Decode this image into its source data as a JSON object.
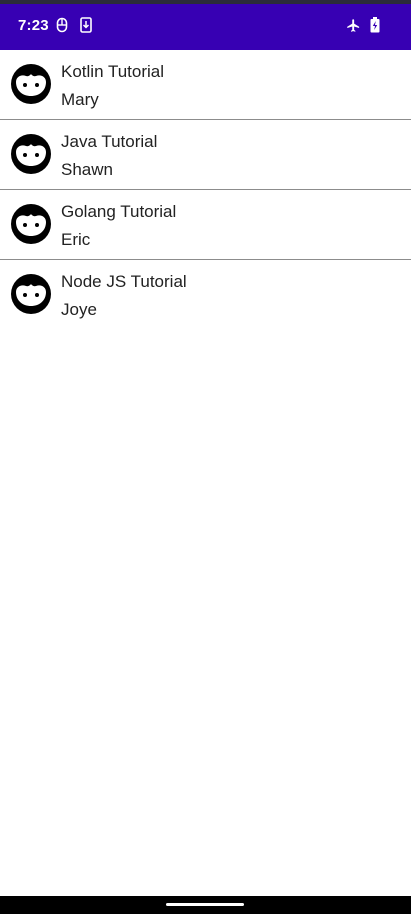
{
  "status_bar": {
    "time": "7:23",
    "background_color": "#3700b3",
    "left_icons": [
      "notification-icon",
      "download-icon"
    ],
    "right_icons": [
      "airplane-mode-icon",
      "battery-charging-icon"
    ]
  },
  "tutorials": [
    {
      "title": "Kotlin Tutorial",
      "author": "Mary",
      "avatar_icon": "face-avatar-icon"
    },
    {
      "title": "Java Tutorial",
      "author": "Shawn",
      "avatar_icon": "face-avatar-icon"
    },
    {
      "title": "Golang Tutorial",
      "author": "Eric",
      "avatar_icon": "face-avatar-icon"
    },
    {
      "title": "Node JS Tutorial",
      "author": "Joye",
      "avatar_icon": "face-avatar-icon"
    }
  ]
}
